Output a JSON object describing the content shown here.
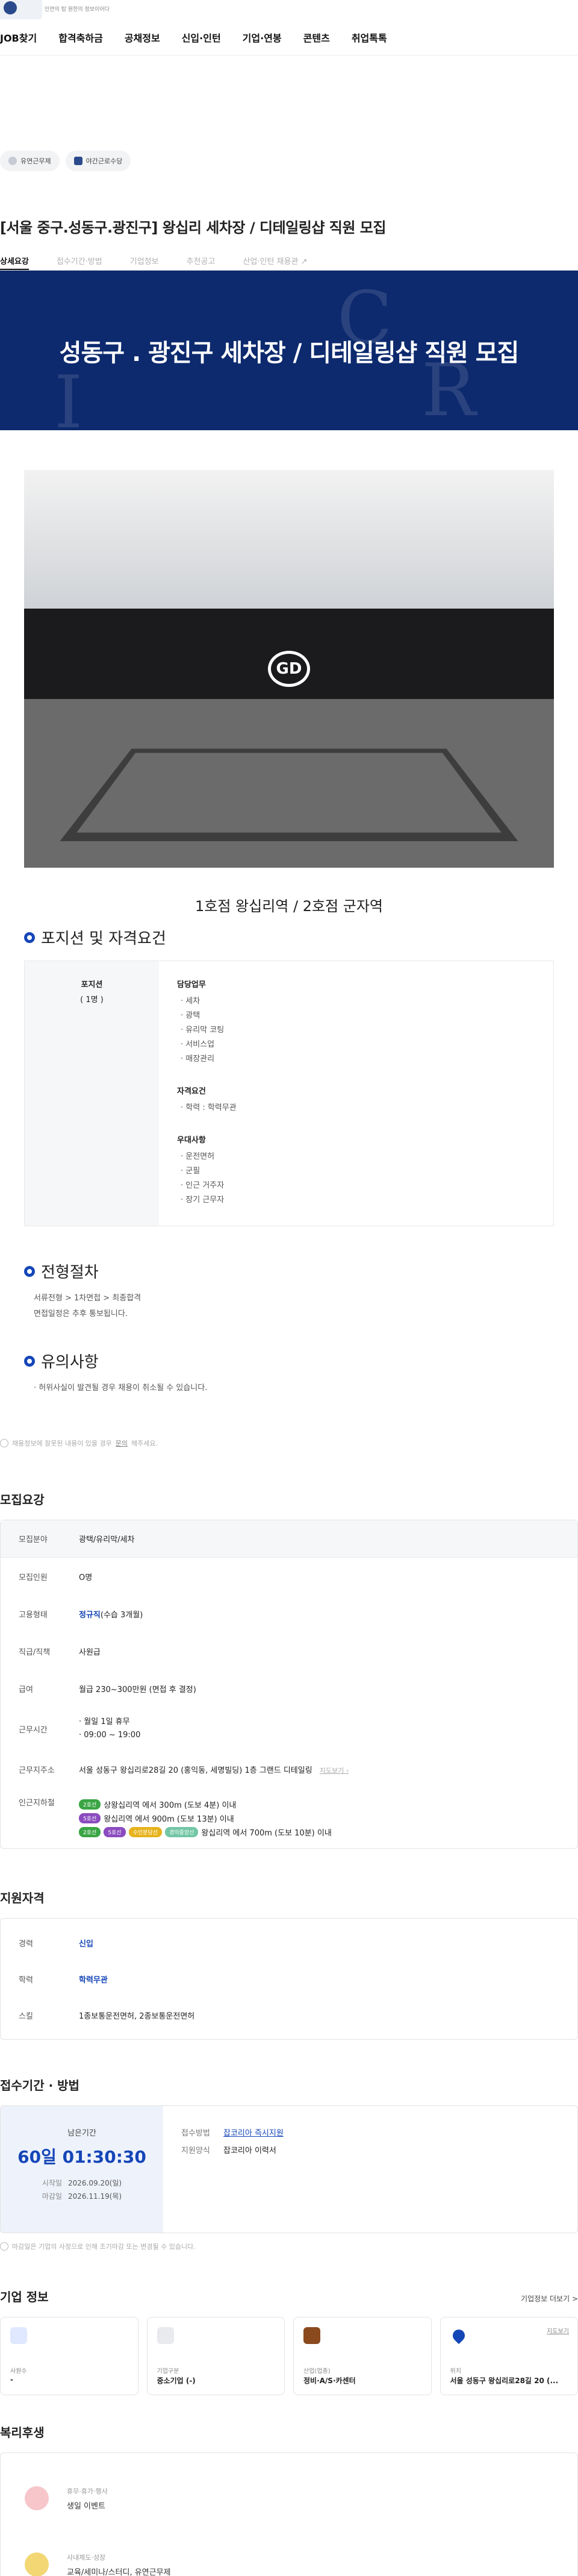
{
  "header": {
    "logo_tagline": "인연의 탑 원한의 정보이어다",
    "nav": [
      "JOB찾기",
      "합격축하금",
      "공채정보",
      "신입·인턴",
      "기업·연봉",
      "콘텐츠",
      "취업톡톡"
    ]
  },
  "chips": [
    {
      "label": "유연근무제",
      "icon": "clock-icon",
      "color": "#c7cbd3"
    },
    {
      "label": "야간근로수당",
      "icon": "building-icon",
      "color": "#2b4a8b"
    }
  ],
  "job": {
    "title": "[서울 중구.성동구.광진구] 왕십리 세차장 / 디테일링샵 직원 모집",
    "tabs": [
      "상세요강",
      "접수기간·방법",
      "기업정보",
      "추천공고",
      "산업·인턴 채용관"
    ]
  },
  "banner": {
    "headline": "성동구 . 광진구 세차장 / 디테일링샵 직원 모집",
    "brand_color": "#0d2a6e"
  },
  "photo": {
    "logo_text": "GD"
  },
  "caption": "1호점 왕십리역 / 2호점 군자역",
  "position": {
    "heading": "포지션 및 자격요건",
    "role_title": "포지션",
    "role_count": "( 1명 )",
    "groups": [
      {
        "title": "담당업무",
        "items": [
          "· 세차",
          "· 광택",
          "· 유리막 코팅",
          "· 서비스업",
          "· 매장관리"
        ]
      },
      {
        "title": "자격요건",
        "items": [
          "· 학력 : 학력무관"
        ]
      },
      {
        "title": "우대사항",
        "items": [
          "· 운전면허",
          "· 군필",
          "· 인근 거주자",
          "· 장기 근무자"
        ]
      }
    ]
  },
  "process": {
    "heading": "전형절차",
    "lines": [
      "서류전형 > 1차면접 > 최종합격",
      "면접일정은 추후 통보됩니다."
    ]
  },
  "caution": {
    "heading": "유의사항",
    "lines": [
      "· 허위사실이 발견될 경우 채용이 취소될 수 있습니다."
    ]
  },
  "notice": {
    "text": "채용정보에 잘못된 내용이 있을 경우",
    "link": "문의",
    "suffix": "해주세요."
  },
  "recruit": {
    "heading": "모집요강",
    "field_label": "모집분야",
    "field_value": "광택/유리막/세차",
    "rows": [
      {
        "k": "모집인원",
        "v": "O명"
      },
      {
        "k": "고용형태",
        "v": "정규직",
        "v2": "(수습 3개월)"
      },
      {
        "k": "직급/직책",
        "v": "사원급"
      },
      {
        "k": "급여",
        "v": "월급 230~300만원 (면접 후 결정)"
      }
    ],
    "hours_label": "근무시간",
    "hours": [
      "· 월일 1일 휴무",
      "· 09:00 ~ 19:00"
    ],
    "addr_label": "근무지주소",
    "addr": "서울 성동구 왕십리로28길 20 (홍익동, 세명빌딩) 1층 그랜드 디테일링",
    "map_link": "지도보기",
    "station_label": "인근지하철",
    "stations": [
      {
        "pills": [
          {
            "t": "2호선",
            "c": "#3aa544"
          }
        ],
        "text": "상왕십리역 에서 300m (도보 4분) 이내"
      },
      {
        "pills": [
          {
            "t": "5호선",
            "c": "#8b4bbf"
          }
        ],
        "text": "왕십리역 에서 900m (도보 13분) 이내"
      },
      {
        "pills": [
          {
            "t": "2호선",
            "c": "#3aa544"
          },
          {
            "t": "5호선",
            "c": "#8b4bbf"
          },
          {
            "t": "수인분당선",
            "c": "#e7b31b"
          },
          {
            "t": "경의중앙선",
            "c": "#72c6a5"
          }
        ],
        "text": "왕십리역 에서 700m (도보 10분) 이내"
      }
    ]
  },
  "qualify": {
    "heading": "지원자격",
    "rows": [
      {
        "k": "경력",
        "v": "신입"
      },
      {
        "k": "학력",
        "v": "학력무관"
      },
      {
        "k": "스킬",
        "v": "1종보통운전면허, 2종보통운전면허"
      }
    ]
  },
  "period": {
    "heading": "접수기간 · 방법",
    "left_label": "남은기간",
    "remaining": "60일 01:30:30",
    "start_label": "시작일",
    "start": "2026.09.20(일)",
    "end_label": "마감일",
    "end": "2026.11.19(목)",
    "method_label": "접수방법",
    "method": "잡코리아 즉시지원",
    "form_label": "지원양식",
    "form": "잡코리아 이력서",
    "note": "마감일은 기업의 사정으로 인해 조기마감 또는 변경될 수 있습니다."
  },
  "company": {
    "heading": "기업 정보",
    "more": "기업정보 더보기 >",
    "cards": [
      {
        "label": "사원수",
        "value": "-",
        "icon": "people-icon",
        "color": "#dfe8ff"
      },
      {
        "label": "기업구분",
        "value": "중소기업 (-)",
        "icon": "building-icon",
        "color": "#e8eaee"
      },
      {
        "label": "산업(업종)",
        "value": "정비·A/S·카센터",
        "icon": "briefcase-icon",
        "color": "#8b4a1e"
      },
      {
        "label": "위치",
        "value": "서울 성동구 왕십리로28길 20 (...",
        "icon": "location-icon",
        "color": "#1546b8",
        "link": "지도보기"
      }
    ]
  },
  "welfare": {
    "heading": "복리후생",
    "items": [
      {
        "h": "휴무·휴가·행사",
        "v": "생일 이벤트",
        "color": "#f6c6cb"
      },
      {
        "h": "사내제도·성장",
        "v": "교육/세미나/스터디, 유연근무제",
        "color": "#f2d774"
      }
    ]
  }
}
